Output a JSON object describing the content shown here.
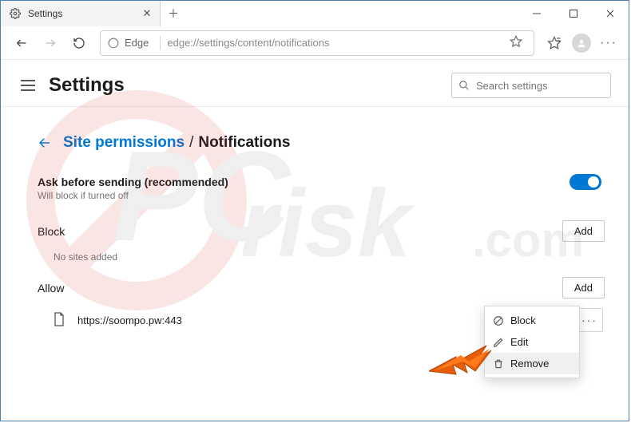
{
  "window": {
    "tab_title": "Settings"
  },
  "toolbar": {
    "edge_label": "Edge",
    "url": "edge://settings/content/notifications"
  },
  "header": {
    "title": "Settings",
    "search_placeholder": "Search settings"
  },
  "breadcrumb": {
    "link": "Site permissions",
    "sep": "/",
    "current": "Notifications"
  },
  "ask": {
    "title": "Ask before sending (recommended)",
    "subtitle": "Will block if turned off",
    "toggle_on": true
  },
  "block": {
    "label": "Block",
    "add": "Add",
    "empty": "No sites added",
    "sites": []
  },
  "allow": {
    "label": "Allow",
    "add": "Add",
    "sites": [
      {
        "url": "https://soompo.pw:443"
      }
    ]
  },
  "context_menu": {
    "items": [
      {
        "icon": "block",
        "label": "Block"
      },
      {
        "icon": "edit",
        "label": "Edit"
      },
      {
        "icon": "trash",
        "label": "Remove"
      }
    ],
    "hover_index": 2
  },
  "watermark": {
    "text": "PCrisk.com"
  }
}
